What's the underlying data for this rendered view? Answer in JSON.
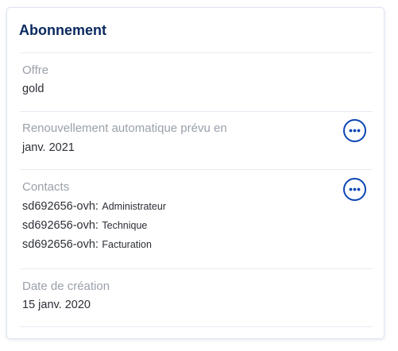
{
  "card": {
    "title": "Abonnement",
    "offer": {
      "label": "Offre",
      "value": "gold"
    },
    "renewal": {
      "label": "Renouvellement automatique prévu en",
      "value": "janv. 2021"
    },
    "contacts": {
      "label": "Contacts",
      "items": [
        {
          "id": "sd692656-ovh:",
          "role": "Administrateur"
        },
        {
          "id": "sd692656-ovh:",
          "role": "Technique"
        },
        {
          "id": "sd692656-ovh:",
          "role": "Facturation"
        }
      ]
    },
    "creation": {
      "label": "Date de création",
      "value": "15 janv. 2020"
    }
  },
  "icons": {
    "more": "more-horizontal-icon"
  },
  "colors": {
    "title": "#0b2a60",
    "accent": "#0a46b4",
    "label": "#9aa0aa",
    "text": "#2c2f36"
  }
}
